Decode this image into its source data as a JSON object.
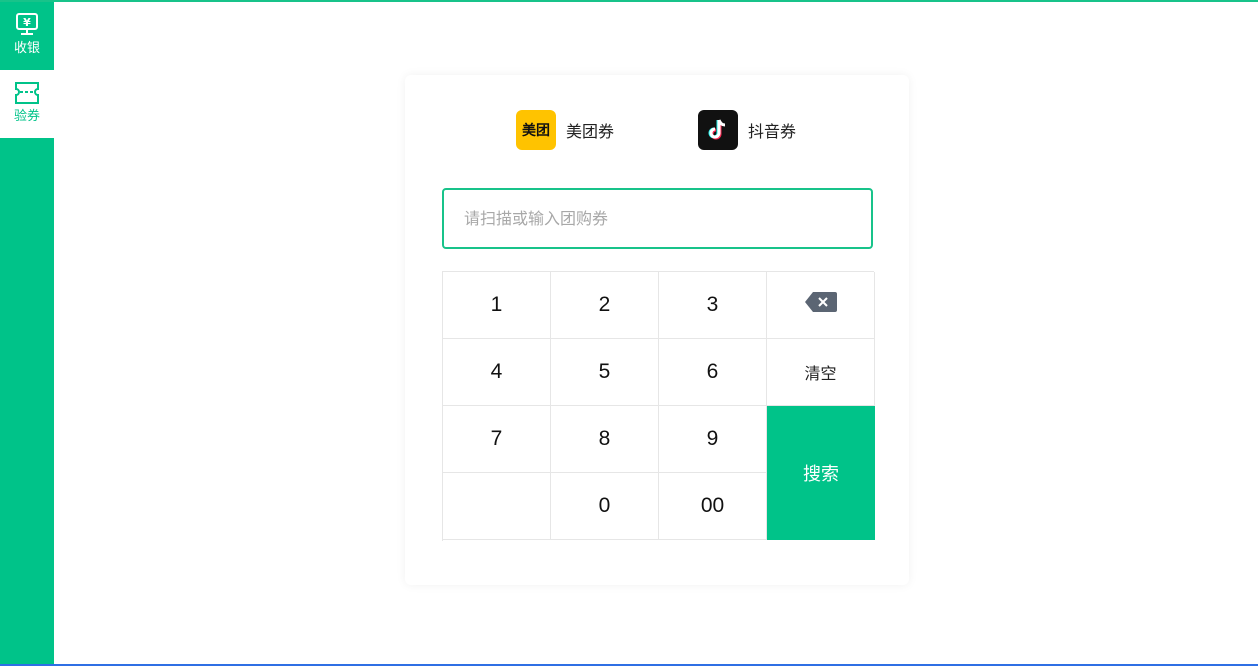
{
  "sidebar": {
    "items": [
      {
        "label": "收银",
        "icon": "cash-register-icon",
        "active": false
      },
      {
        "label": "验券",
        "icon": "ticket-icon",
        "active": true
      }
    ],
    "color": "#00c389"
  },
  "platforms": [
    {
      "logo_text": "美团",
      "label": "美团券",
      "icon": "meituan-logo",
      "color": "#ffc300"
    },
    {
      "label": "抖音券",
      "icon": "douyin-logo",
      "color": "#111111"
    }
  ],
  "search": {
    "placeholder": "请扫描或输入团购券",
    "value": ""
  },
  "keypad": {
    "keys": [
      "1",
      "2",
      "3",
      "4",
      "5",
      "6",
      "7",
      "8",
      "9",
      "0",
      "00"
    ],
    "clear_label": "清空",
    "search_label": "搜索",
    "backspace_icon": "backspace-icon"
  }
}
